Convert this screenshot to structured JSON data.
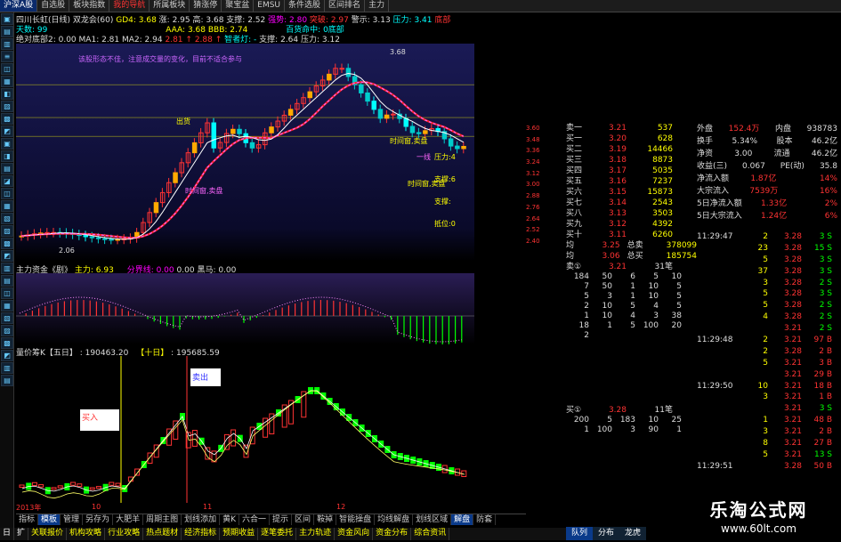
{
  "topbar": [
    "沪深A股",
    "自选股",
    "板块指数",
    "我的导航",
    "所属板块",
    "猜涨停",
    "聚宝盆",
    "EMSU",
    "条件选股",
    "区间排名",
    "主力"
  ],
  "info": {
    "name": "四川长虹(日线) 双龙会(60)",
    "gd4": "GD4: 3.68",
    "zhang": "涨: 2.95",
    "gao": "高: 3.68",
    "zhicheng": "支撑: 2.52",
    "qiangshi": "强势: 2.80",
    "tupo": "突破: 2.97",
    "jingshi": "警示: 3.13",
    "yali": "压力: 3.41",
    "dibu": "底部",
    "tianshu": "天数: 99",
    "aaa": "AAA: 3.68 BBB: 2.74",
    "baihuo": "百货命中: 0底部",
    "line3": "绝对底部2: 0.00",
    "ma1": "MA1: 2.81",
    "ma2": "MA2: 2.94",
    "up1": "2.81 ↑",
    "up2": "2.88 ↑",
    "zhihui": "智者灯: -",
    "zhic2": "支撑: 2.64",
    "yali2": "压力: 3.12"
  },
  "kchart": {
    "note": "该股形态不佳，注意成交量的变化，目前不适合参与",
    "labels": [
      "出货",
      "时间窗,卖盘",
      "时间窗,卖盘",
      "一线",
      "时间窗,卖盘",
      "出货"
    ],
    "price_hi": "3.68",
    "price_lo": "2.06",
    "side": [
      "压力:4",
      "支撑:6",
      "支撑:",
      "抵位:0"
    ]
  },
  "ind": {
    "title": "主力资金《剧》",
    "v1": "主力: 6.93",
    "v2": "分界线: 0.00",
    "v3": "0.00",
    "v4": "黑马: 0.00",
    "scale": [
      "18.00",
      "6.00",
      "-6.00"
    ]
  },
  "vol": {
    "title": "量价筹K【五日】",
    "v5": ": 190463.20",
    "v10": "【十日】",
    "v10v": ": 195685.59",
    "buy": "买入",
    "sell": "卖出",
    "scale": [
      "50000",
      "40000",
      "30000",
      "20000"
    ],
    "bottom": "40",
    "left_scale": [
      "5",
      "4",
      "2",
      "2",
      "1",
      "5",
      "4",
      "3",
      "2",
      "1",
      "0"
    ],
    "x": [
      "2013年",
      "10",
      "11",
      "12"
    ]
  },
  "bottomtabs": [
    "指标",
    "模板",
    "管理",
    "另存为",
    "大肥羊",
    "周期主图",
    "划线添加",
    "黄K",
    "六合一",
    "提示",
    "区间",
    "鞍掉",
    "智能操盘",
    "均线解盘",
    "划线区域",
    "解盘",
    "防套"
  ],
  "bottomtabs2": [
    "日",
    "扩",
    "关联报价",
    "机构攻略",
    "行业攻略",
    "热点题材",
    "经济指标",
    "预期收益",
    "逐笔委托",
    "主力轨迹",
    "资金风向",
    "资金分布",
    "综合资讯"
  ],
  "pricescale": [
    "3.60",
    "3.48",
    "3.36",
    "3.24",
    "3.12",
    "3.00",
    "2.88",
    "2.76",
    "2.64",
    "2.52",
    "2.40"
  ],
  "orders": [
    {
      "l": "卖一",
      "p": "3.21",
      "v": "537"
    },
    {
      "l": "买一",
      "p": "3.20",
      "v": "628"
    },
    {
      "l": "买二",
      "p": "3.19",
      "v": "14466"
    },
    {
      "l": "买三",
      "p": "3.18",
      "v": "8873"
    },
    {
      "l": "买四",
      "p": "3.17",
      "v": "5035"
    },
    {
      "l": "买五",
      "p": "3.16",
      "v": "7237"
    },
    {
      "l": "买六",
      "p": "3.15",
      "v": "15873"
    },
    {
      "l": "买七",
      "p": "3.14",
      "v": "2543"
    },
    {
      "l": "买八",
      "p": "3.13",
      "v": "3503"
    },
    {
      "l": "买九",
      "p": "3.12",
      "v": "4392"
    },
    {
      "l": "买十",
      "p": "3.11",
      "v": "6260"
    }
  ],
  "avg": [
    {
      "l": "均",
      "p": "3.25",
      "k": "总卖",
      "v": "378099"
    },
    {
      "l": "均",
      "p": "3.06",
      "k": "总买",
      "v": "185754"
    }
  ],
  "sell_q": {
    "label": "卖①",
    "price": "3.21",
    "count": "31笔",
    "rows": [
      [
        "184",
        "50",
        "6",
        "5",
        "10"
      ],
      [
        "7",
        "50",
        "1",
        "10",
        "5"
      ],
      [
        "5",
        "3",
        "1",
        "10",
        "5"
      ],
      [
        "2",
        "10",
        "5",
        "4",
        "5"
      ],
      [
        "1",
        "10",
        "4",
        "3",
        "38"
      ],
      [
        "18",
        "1",
        "5",
        "100",
        "20"
      ],
      [
        "2",
        "",
        "",
        "",
        ""
      ]
    ]
  },
  "buy_q": {
    "label": "买①",
    "price": "3.28",
    "count": "11笔",
    "rows": [
      [
        "200",
        "5",
        "183",
        "10",
        "25"
      ],
      [
        "1",
        "100",
        "3",
        "90",
        "1"
      ]
    ]
  },
  "stats": [
    {
      "a": "外盘",
      "av": "152.4万",
      "b": "内盘",
      "bv": "938783"
    },
    {
      "a": "换手",
      "av": "5.34%",
      "b": "股本",
      "bv": "46.2亿"
    },
    {
      "a": "净资",
      "av": "3.00",
      "b": "流通",
      "bv": "46.2亿"
    },
    {
      "a": "收益(三)",
      "av": "0.067",
      "b": "PE(动)",
      "bv": "35.8"
    },
    {
      "a": "净流入额",
      "av": "1.87亿",
      "b": "",
      "bv": "14%"
    },
    {
      "a": "大宗流入",
      "av": "7539万",
      "b": "",
      "bv": "16%"
    },
    {
      "a": "5日净流入额",
      "av": "1.33亿",
      "b": "",
      "bv": "2%"
    },
    {
      "a": "5日大宗流入",
      "av": "1.24亿",
      "b": "",
      "bv": "6%"
    }
  ],
  "ticks": [
    {
      "t": "11:29:47",
      "v": "2",
      "p": "3.28",
      "q": "3 S"
    },
    {
      "t": "",
      "v": "23",
      "p": "3.28",
      "q": "15 S"
    },
    {
      "t": "",
      "v": "5",
      "p": "3.28",
      "q": "3 S"
    },
    {
      "t": "",
      "v": "37",
      "p": "3.28",
      "q": "3 S"
    },
    {
      "t": "",
      "v": "3",
      "p": "3.28",
      "q": "2 S"
    },
    {
      "t": "",
      "v": "5",
      "p": "3.28",
      "q": "3 S"
    },
    {
      "t": "",
      "v": "5",
      "p": "3.28",
      "q": "2 S"
    },
    {
      "t": "",
      "v": "4",
      "p": "3.28",
      "q": "2 S"
    },
    {
      "t": "",
      "v": "",
      "p": "3.21",
      "q": "2 S"
    },
    {
      "t": "11:29:48",
      "v": "2",
      "p": "3.21",
      "q": "97 B"
    },
    {
      "t": "",
      "v": "2",
      "p": "3.28",
      "q": "2 B"
    },
    {
      "t": "",
      "v": "5",
      "p": "3.21",
      "q": "3 B"
    },
    {
      "t": "",
      "v": "",
      "p": "3.21",
      "q": "29 B"
    },
    {
      "t": "11:29:50",
      "v": "10",
      "p": "3.21",
      "q": "18 B"
    },
    {
      "t": "",
      "v": "3",
      "p": "3.21",
      "q": "1 B"
    },
    {
      "t": "",
      "v": "",
      "p": "3.21",
      "q": "3 S"
    },
    {
      "t": "",
      "v": "1",
      "p": "3.21",
      "q": "48 B"
    },
    {
      "t": "",
      "v": "3",
      "p": "3.21",
      "q": "2 B"
    },
    {
      "t": "",
      "v": "8",
      "p": "3.21",
      "q": "27 B"
    },
    {
      "t": "",
      "v": "5",
      "p": "3.21",
      "q": "13 S"
    },
    {
      "t": "11:29:51",
      "v": "",
      "p": "3.28",
      "q": "50 B"
    }
  ],
  "rtabs": [
    "队列",
    "分布",
    "龙虎"
  ],
  "watermark": {
    "title": "乐淘公式网",
    "url": "www.60lt.com"
  },
  "colors": {
    "up": "#ff3333",
    "down": "#00ff00",
    "ma": "#ffff00",
    "bg": "#000000"
  }
}
